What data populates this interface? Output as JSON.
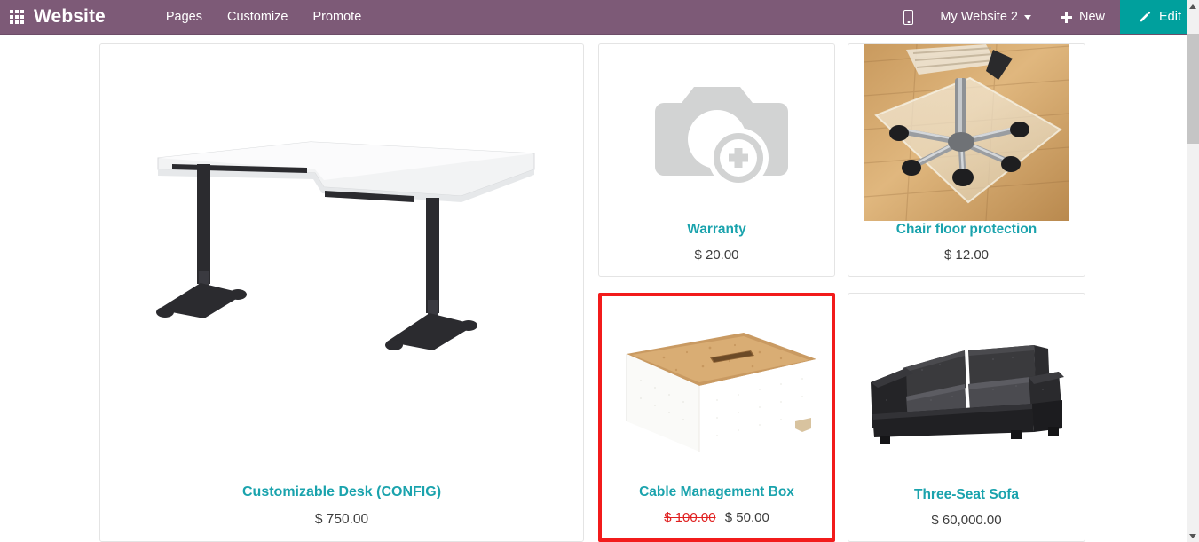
{
  "navbar": {
    "apps_icon": "apps-grid-icon",
    "brand": "Website",
    "links": [
      {
        "label": "Pages"
      },
      {
        "label": "Customize"
      },
      {
        "label": "Promote"
      }
    ],
    "mobile_preview_icon": "mobile-phone-icon",
    "site_selector": {
      "label": "My Website 2",
      "caret_icon": "chevron-down-icon"
    },
    "new_button": {
      "label": "New",
      "icon": "plus-icon"
    },
    "edit_button": {
      "label": "Edit",
      "icon": "pencil-icon",
      "background_color": "#00a09d"
    },
    "background_color": "#7d5a77"
  },
  "colors": {
    "navbar_purple": "#7d5a77",
    "edit_teal": "#00a09d",
    "product_title_teal": "#1aa3ad",
    "price_text": "#3c3c3c",
    "old_price_red": "#e02020",
    "highlight_border_red": "#f21b1b",
    "card_border": "#e4e4e4"
  },
  "products": [
    {
      "id": "customizable-desk",
      "name": "Customizable Desk (CONFIG)",
      "price": "$ 750.00",
      "old_price": null,
      "image_alt": "white-corner-desk-image",
      "highlighted": false
    },
    {
      "id": "warranty",
      "name": "Warranty",
      "price": "$ 20.00",
      "old_price": null,
      "image_alt": "image-placeholder-camera-icon",
      "highlighted": false
    },
    {
      "id": "chair-floor-protection",
      "name": "Chair floor protection",
      "price": "$ 12.00",
      "old_price": null,
      "image_alt": "chair-floor-mat-photo",
      "highlighted": false
    },
    {
      "id": "cable-management-box",
      "name": "Cable Management Box",
      "price": "$ 50.00",
      "old_price": "$ 100.00",
      "image_alt": "white-cable-box-with-cork-lid-image",
      "highlighted": true
    },
    {
      "id": "three-seat-sofa",
      "name": "Three-Seat Sofa",
      "price": "$ 60,000.00",
      "old_price": null,
      "image_alt": "black-leather-sofa-image",
      "highlighted": false
    }
  ],
  "scrollbar": {
    "up_arrow": "scroll-up-arrow-icon",
    "down_arrow": "scroll-down-arrow-icon",
    "thumb": "scroll-thumb"
  }
}
